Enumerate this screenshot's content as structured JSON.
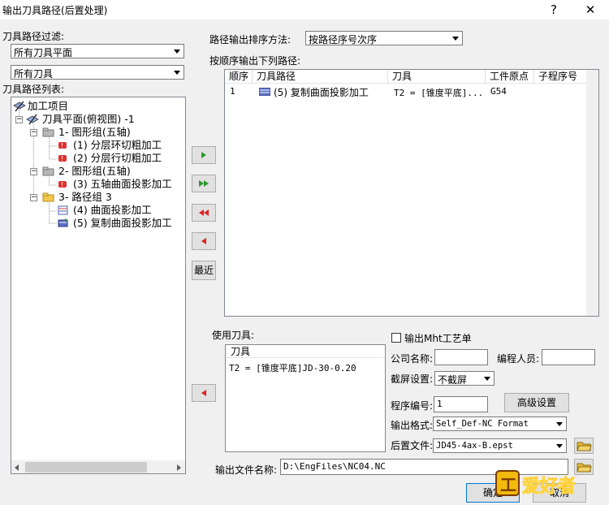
{
  "window": {
    "title": "输出刀具路径(后置处理)",
    "help": "?",
    "close": "✕"
  },
  "filter": {
    "label": "刀具路径过滤:",
    "plane_value": "所有刀具平面",
    "tool_value": "所有刀具"
  },
  "list_label": "刀具路径列表:",
  "tree": {
    "root": "加工项目",
    "plane": "刀具平面(俯视图) -1",
    "group1": "1- 图形组(五轴)",
    "g1_item1": "(1) 分层环切粗加工",
    "g1_item2": "(2) 分层行切粗加工",
    "group2": "2- 图形组(五轴)",
    "g2_item1": "(3) 五轴曲面投影加工",
    "group3": "3- 路径组 3",
    "g3_item1": "(4) 曲面投影加工",
    "g3_item2": "(5) 复制曲面投影加工"
  },
  "sort": {
    "label": "路径输出排序方法:",
    "value": "按路径序号次序"
  },
  "output_list": {
    "label": "按顺序输出下列路径:",
    "headers": [
      "顺序",
      "刀具路径",
      "刀具",
      "工件原点",
      "子程序号"
    ],
    "rows": [
      {
        "order": "1",
        "path": "(5) 复制曲面投影加工",
        "tool": "T2 = [锥度平底]...",
        "origin": "G54",
        "sub": ""
      }
    ]
  },
  "buttons": {
    "recent": "最近",
    "advanced": "高级设置",
    "ok": "确定",
    "cancel": "取消"
  },
  "tools": {
    "label": "使用刀具:",
    "header": "刀具",
    "row": "T2 = [锥度平底]JD-30-0.20"
  },
  "mht": {
    "label": "输出Mht工艺单"
  },
  "company": {
    "label": "公司名称:",
    "value": ""
  },
  "programmer": {
    "label": "编程人员:",
    "value": ""
  },
  "cutoff": {
    "label": "截屏设置:",
    "value": "不截屏"
  },
  "prognum": {
    "label": "程序编号:",
    "value": "1"
  },
  "format": {
    "label": "输出格式:",
    "value": "Self_Def-NC Format"
  },
  "postfile": {
    "label": "后置文件:",
    "value": "JD45-4ax-B.epst"
  },
  "outfile": {
    "label": "输出文件名称:",
    "value": "D:\\EngFiles\\NC04.NC"
  },
  "watermark": {
    "text": "爱好者"
  },
  "colors": {
    "accent": "#0078d7",
    "tree_line": "#a0a0a0"
  }
}
